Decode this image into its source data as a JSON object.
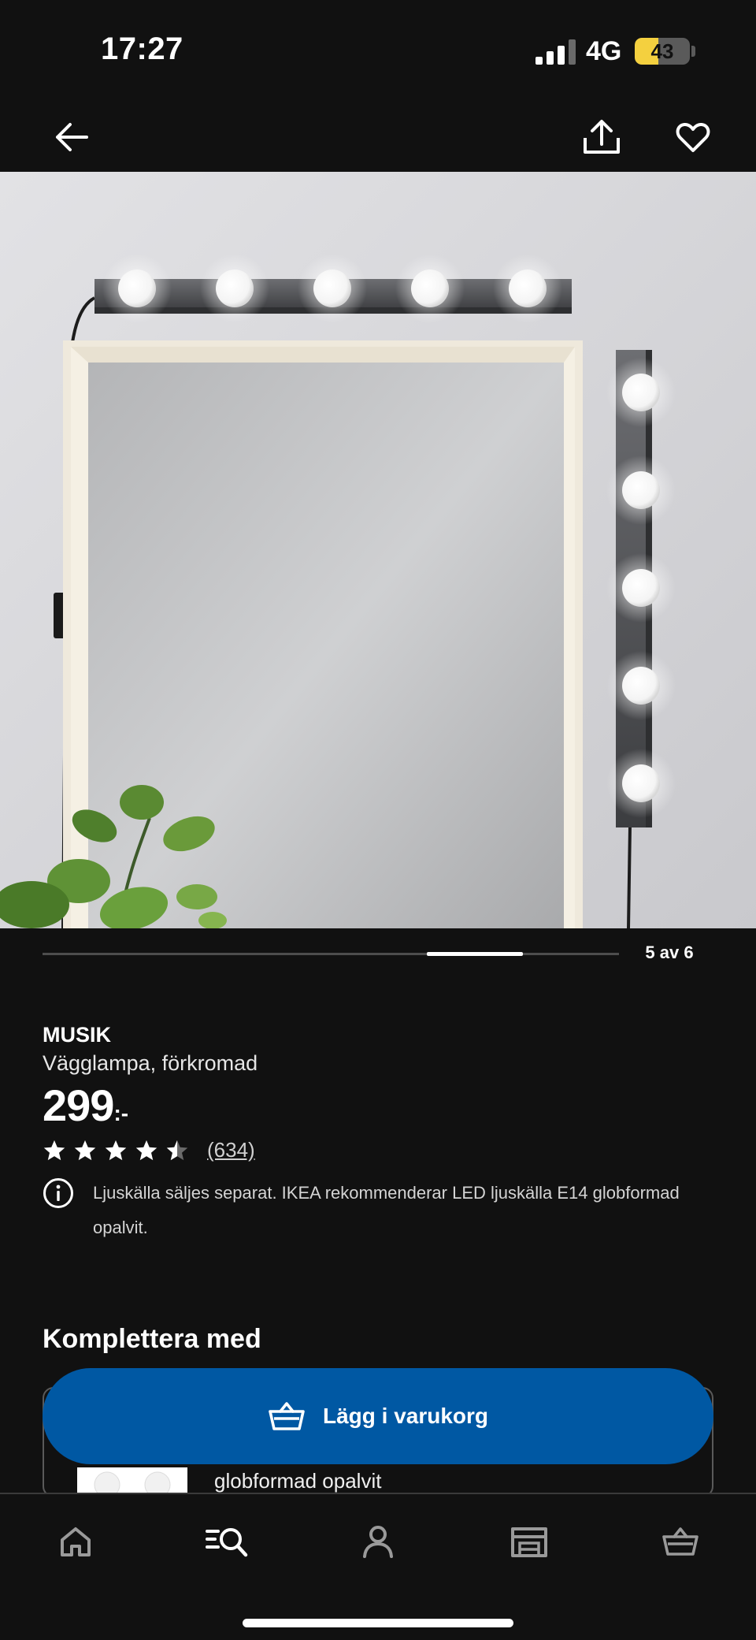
{
  "status_bar": {
    "time": "17:27",
    "network": "4G",
    "battery": "43",
    "battery_level": 0.43,
    "battery_color": "#f4d03f"
  },
  "header": {
    "back_icon": "arrow-left-icon",
    "share_icon": "share-icon",
    "favorite_icon": "heart-icon"
  },
  "carousel": {
    "counter": "5 av 6",
    "current": 5,
    "total": 6
  },
  "product": {
    "brand": "MUSIK",
    "description": "Vägglampa, förkromad",
    "price": "299",
    "price_suffix": ":-",
    "rating": 4.5,
    "reviews": "(634)",
    "info_text": "Ljuskälla säljes separat. IKEA rekommenderar LED ljuskälla E14 globformad opalvit."
  },
  "complement": {
    "title": "Komplettera med",
    "item_text": "globformad opalvit"
  },
  "cart_button": {
    "label": "Lägg i varukorg",
    "color": "#0058a3"
  },
  "bottom_nav": {
    "items": [
      {
        "icon": "home-icon"
      },
      {
        "icon": "search-list-icon"
      },
      {
        "icon": "profile-icon"
      },
      {
        "icon": "store-icon"
      },
      {
        "icon": "basket-icon"
      }
    ]
  }
}
